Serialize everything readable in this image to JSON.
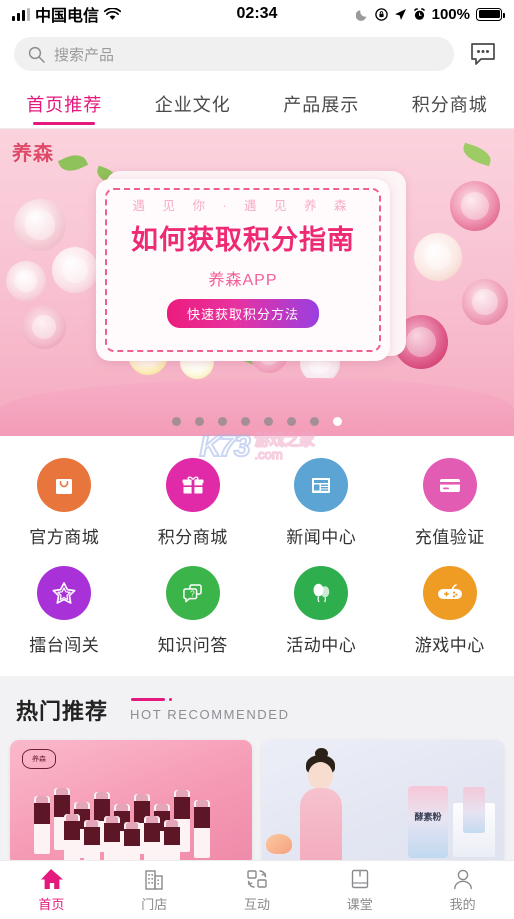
{
  "status_bar": {
    "carrier": "中国电信",
    "time": "02:34",
    "battery_percent": "100%",
    "icons": [
      "signal-bars-icon",
      "wifi-icon",
      "moon-icon",
      "rotation-lock-icon",
      "location-arrow-icon",
      "alarm-clock-icon",
      "battery-icon"
    ]
  },
  "search": {
    "placeholder": "搜索产品",
    "icon": "search-icon",
    "message_icon": "message-bubble-icon"
  },
  "tabs": [
    {
      "label": "首页推荐",
      "active": true
    },
    {
      "label": "企业文化",
      "active": false
    },
    {
      "label": "产品展示",
      "active": false
    },
    {
      "label": "积分商城",
      "active": false
    }
  ],
  "banner": {
    "logo": "养森",
    "tagline": "遇 见 你 · 遇 见 养 森",
    "title": "如何获取积分指南",
    "subtitle": "养森APP",
    "button_label": "快速获取积分方法",
    "dots_total": 8,
    "dots_active_index": 7,
    "accent_color": "#ef2a75",
    "button_gradient_start": "#ec1c7d",
    "button_gradient_end": "#9a3fe0"
  },
  "watermark": {
    "brand": "K73",
    "cn": "游戏之家",
    "domain": ".com"
  },
  "grid": [
    {
      "label": "官方商城",
      "icon": "shopping-bag-icon",
      "color": "#e8763c"
    },
    {
      "label": "积分商城",
      "icon": "gift-icon",
      "color": "#e02aa8"
    },
    {
      "label": "新闻中心",
      "icon": "newspaper-icon",
      "color": "#5ba4d4"
    },
    {
      "label": "充值验证",
      "icon": "credit-card-icon",
      "color": "#e25cb4"
    },
    {
      "label": "擂台闯关",
      "icon": "star-icon",
      "color": "#a832d8"
    },
    {
      "label": "知识问答",
      "icon": "question-chat-icon",
      "color": "#3bb54a"
    },
    {
      "label": "活动中心",
      "icon": "balloons-icon",
      "color": "#2fae4e"
    },
    {
      "label": "游戏中心",
      "icon": "gamepad-icon",
      "color": "#ef9c25"
    }
  ],
  "hot_section": {
    "title": "热门推荐",
    "subtitle": "HOT RECOMMENDED",
    "accent_color": "#e5187e",
    "cards": [
      {
        "name": "drink-bottles-card",
        "badge": "养森",
        "alt": "养森饮品瓶装产品"
      },
      {
        "name": "enzyme-powder-card",
        "product": "酵素粉",
        "alt": "酵素粉礼盒与模特"
      }
    ]
  },
  "bottom_nav": [
    {
      "label": "首页",
      "icon": "home-icon",
      "active": true
    },
    {
      "label": "门店",
      "icon": "store-building-icon",
      "active": false
    },
    {
      "label": "互动",
      "icon": "exchange-arrows-icon",
      "active": false
    },
    {
      "label": "课堂",
      "icon": "book-icon",
      "active": false
    },
    {
      "label": "我的",
      "icon": "person-icon",
      "active": false
    }
  ]
}
